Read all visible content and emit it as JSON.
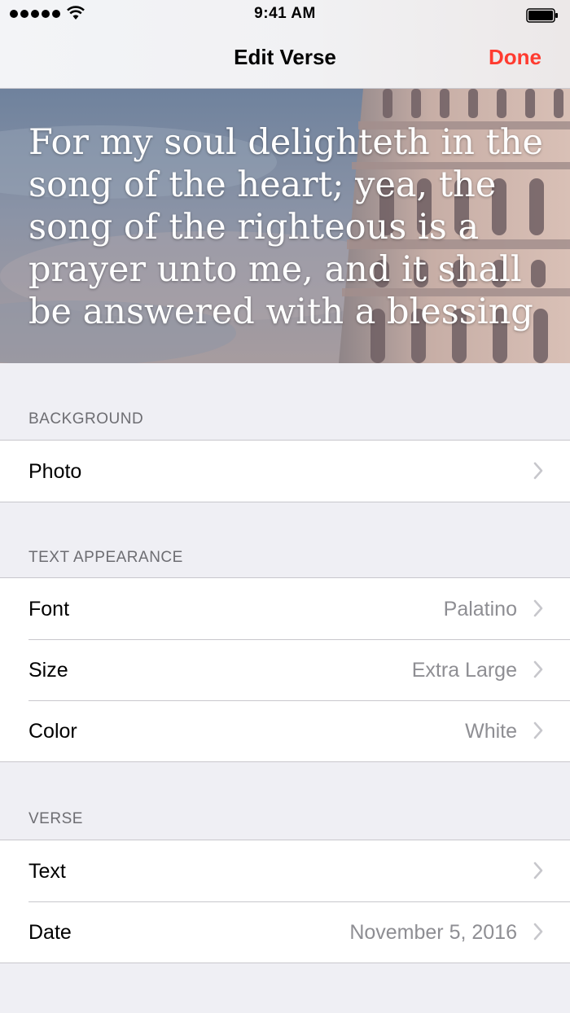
{
  "status": {
    "time": "9:41 AM"
  },
  "nav": {
    "title": "Edit Verse",
    "done_label": "Done"
  },
  "verse": {
    "text": "For my soul delighteth in the\nsong of the heart; yea, the\nsong of the righteous is a\nprayer unto me, and it shall\nbe answered with a blessing"
  },
  "sections": {
    "background": {
      "header": "BACKGROUND",
      "rows": [
        {
          "label": "Photo",
          "value": ""
        }
      ]
    },
    "text_appearance": {
      "header": "TEXT APPEARANCE",
      "rows": [
        {
          "label": "Font",
          "value": "Palatino"
        },
        {
          "label": "Size",
          "value": "Extra Large"
        },
        {
          "label": "Color",
          "value": "White"
        }
      ]
    },
    "verse": {
      "header": "VERSE",
      "rows": [
        {
          "label": "Text",
          "value": ""
        },
        {
          "label": "Date",
          "value": "November 5, 2016"
        }
      ]
    }
  },
  "colors": {
    "accent": "#ff3b30",
    "secondary_text": "#8e8e93",
    "background": "#efeff4"
  }
}
